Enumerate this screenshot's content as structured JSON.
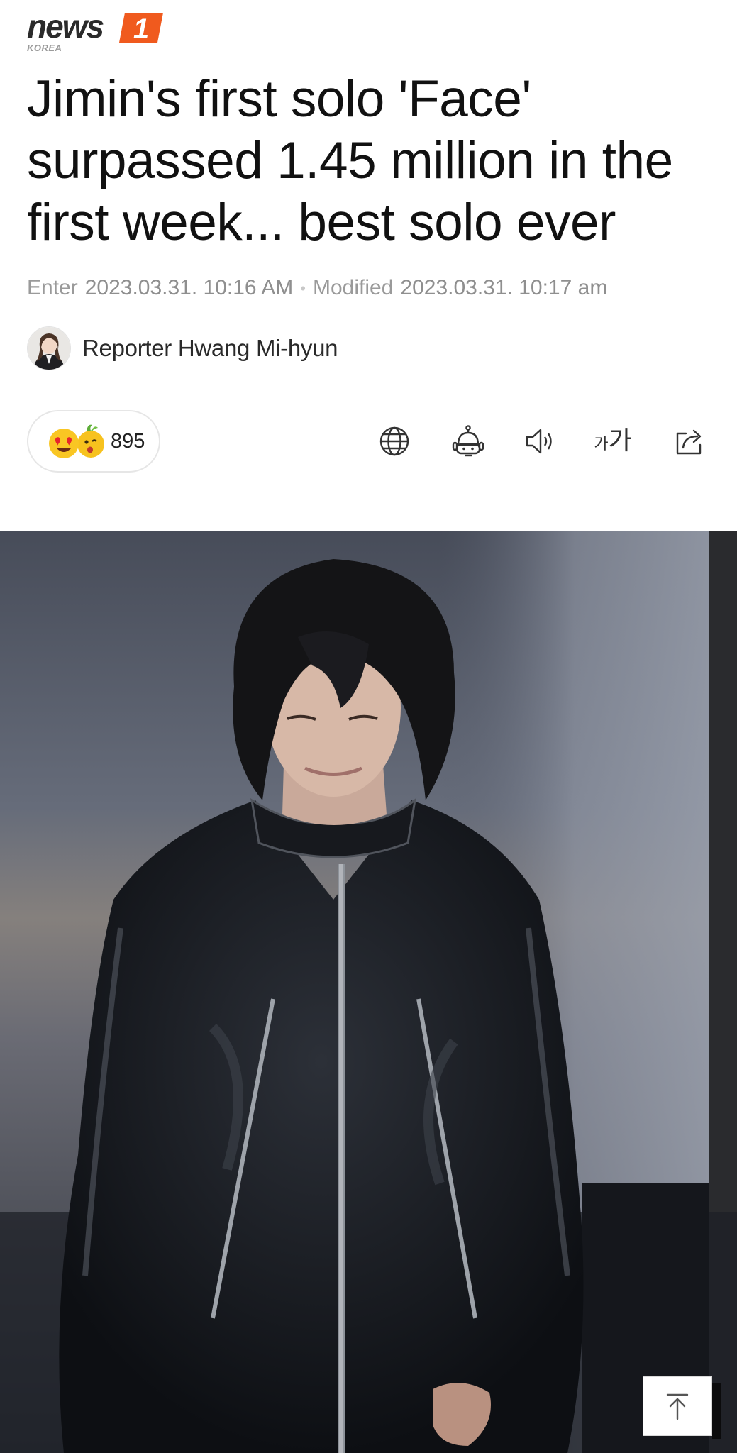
{
  "logo": {
    "word": "news",
    "badge": "1",
    "sub": "KOREA"
  },
  "article": {
    "headline": "Jimin's first solo 'Face' surpassed 1.45 million in the first week... best solo ever",
    "entered_label": "Enter",
    "entered_value": "2023.03.31. 10:16 AM",
    "modified_label": "Modified",
    "modified_value": "2023.03.31. 10:17 am",
    "separator": "•"
  },
  "reporter": {
    "name": "Reporter Hwang Mi-hyun"
  },
  "reactions": {
    "count": "895"
  },
  "toolbar": {
    "icons": [
      "globe-icon",
      "robot-icon",
      "speaker-icon",
      "font-size-icon",
      "share-icon"
    ],
    "font_size_small": "가",
    "font_size_big": "가"
  },
  "colors": {
    "brand_orange": "#f05a1e",
    "text_dark": "#111111",
    "meta_gray": "#8f8f8f"
  },
  "back_to_top": {
    "icon": "arrow-up-icon"
  }
}
